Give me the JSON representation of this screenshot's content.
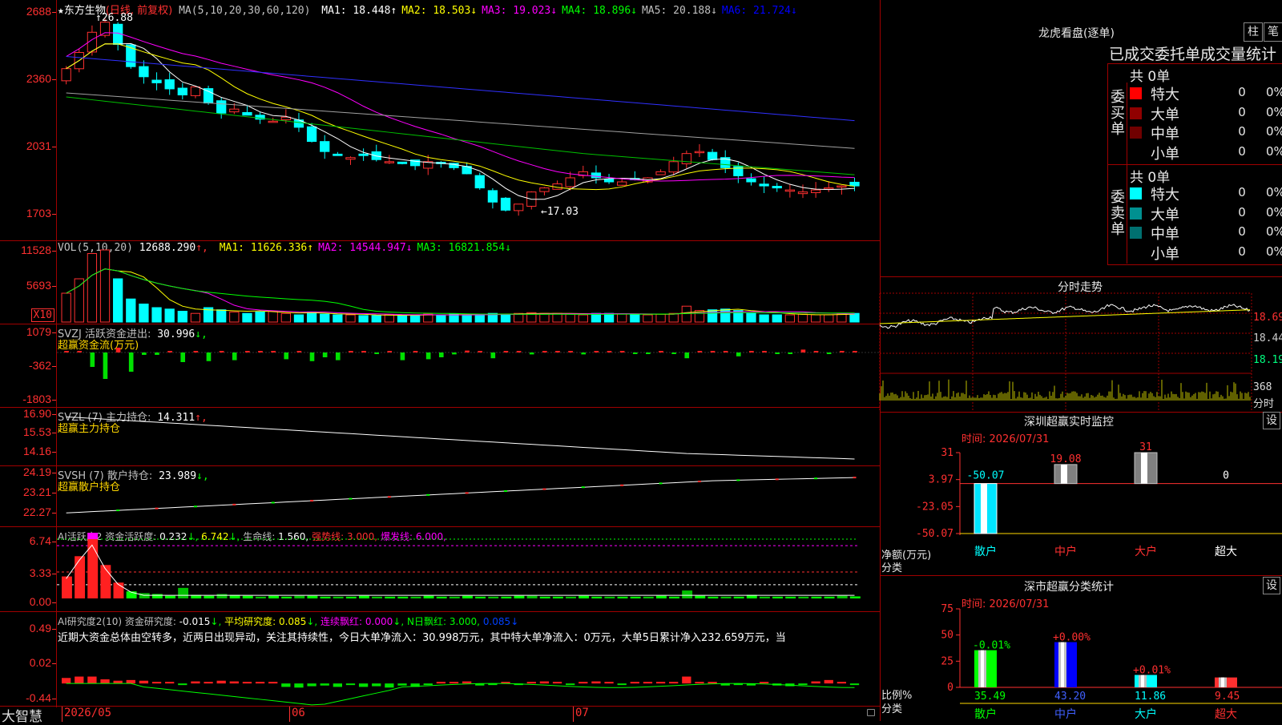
{
  "stock": {
    "name": "东方生物",
    "mode": "(日线, 前复权)",
    "star": "★",
    "ma_header": "MA(5,10,20,30,60,120)",
    "ma": [
      {
        "label": "MA1:",
        "value": "18.448",
        "arrow": "↑",
        "color": "#ffffff"
      },
      {
        "label": "MA2:",
        "value": "18.503",
        "arrow": "↓",
        "color": "#ffff00"
      },
      {
        "label": "MA3:",
        "value": "19.023",
        "arrow": "↓",
        "color": "#ff00ff"
      },
      {
        "label": "MA4:",
        "value": "18.896",
        "arrow": "↓",
        "color": "#00ff00"
      },
      {
        "label": "MA5:",
        "value": "20.188",
        "arrow": "↓",
        "color": "#c0c0c0"
      },
      {
        "label": "MA6:",
        "value": "21.724",
        "arrow": "↓",
        "color": "#0000ff"
      }
    ],
    "high_note": "26.88",
    "low_note": "17.03",
    "y_ticks": [
      "2688",
      "2360",
      "2031",
      "1703"
    ]
  },
  "vol": {
    "title": "VOL(5,10,20)",
    "value": "12688.290",
    "ma": [
      {
        "label": "MA1:",
        "value": "11626.336",
        "arrow": "↑",
        "color": "#ffff00"
      },
      {
        "label": "MA2:",
        "value": "14544.947",
        "arrow": "↓",
        "color": "#ff00ff"
      },
      {
        "label": "MA3:",
        "value": "16821.854",
        "arrow": "↓",
        "color": "#00ff00"
      }
    ],
    "y_ticks": [
      "11528",
      "5693"
    ],
    "unit": "X10"
  },
  "svzj": {
    "title": "SVZJ  活跃资金进出:",
    "value": "30.996",
    "arrow": "↓,",
    "subtitle": "超赢资金流(万元)",
    "y_ticks": [
      "1079",
      "-362",
      "-1803"
    ]
  },
  "svzl": {
    "title": "SVZL (7) 主力持仓:",
    "value": "14.311",
    "arrow": "↑,",
    "subtitle": "超赢主力持仓",
    "y_ticks": [
      "16.90",
      "15.53",
      "14.16"
    ]
  },
  "svsh": {
    "title": "SVSH (7) 散户持仓:",
    "value": "23.989",
    "arrow": "↓,",
    "subtitle": "超赢散户持仓",
    "y_ticks": [
      "24.19",
      "23.21",
      "22.27"
    ]
  },
  "ai1": {
    "title": "AI活跃度2 资金活跃度:",
    "value": "0.232",
    "arrow": "↓,",
    "v2": "6.742",
    "life": "生命线:",
    "life_val": "1.560,",
    "strong": "强势线:",
    "strong_val": "3.000,",
    "burst": "爆发线:",
    "burst_val": "6.000,",
    "y_ticks": [
      "6.74",
      "3.33",
      "0.00"
    ]
  },
  "ai2": {
    "title": "AI研究度2(10) 资金研究度:",
    "value": "-0.015",
    "arrow": "↓,",
    "avg": "平均研究度:",
    "avg_val": "0.085",
    "cont": "连续飘红:",
    "cont_val": "0.000",
    "nday": "N日飘红:",
    "nday_val": "3.000,",
    "extra": "0.085",
    "comment": "近期大资金总体由空转多，近两日出现异动，关注其持续性，今日大单净流入：30.998万元，其中特大单净流入：0万元，大单5日累计净入232.659万元，当",
    "y_ticks": [
      "0.49",
      "0.02",
      "-0.44"
    ]
  },
  "bottom": {
    "brand": "大智慧",
    "dates": [
      "2026/05",
      "06",
      "07"
    ]
  },
  "lhb": {
    "title": "龙虎看盘(逐单)",
    "btn1": "柱",
    "btn2": "笔",
    "header": "已成交委托单成交量统计",
    "buy_label": "委买单",
    "sell_label": "委卖单",
    "buy_total": "共 0单",
    "sell_total": "共 0单",
    "buy_rows": [
      {
        "label": "特大",
        "count": "0",
        "pct": "0%",
        "color": "#ff0000"
      },
      {
        "label": "大单",
        "count": "0",
        "pct": "0%",
        "color": "#900000"
      },
      {
        "label": "中单",
        "count": "0",
        "pct": "0%",
        "color": "#700000"
      },
      {
        "label": "小单",
        "count": "0",
        "pct": "0%",
        "color": "#000000"
      }
    ],
    "sell_rows": [
      {
        "label": "特大",
        "count": "0",
        "pct": "0%",
        "color": "#00ffff"
      },
      {
        "label": "大单",
        "count": "0",
        "pct": "0%",
        "color": "#009090"
      },
      {
        "label": "中单",
        "count": "0",
        "pct": "0%",
        "color": "#007070"
      },
      {
        "label": "小单",
        "count": "0",
        "pct": "0%",
        "color": "#000000"
      }
    ]
  },
  "fenshi": {
    "title": "分时走势",
    "y_ticks": [
      "18.69",
      "18.44",
      "18.19"
    ],
    "vol_label": "368",
    "vol_unit": "分时"
  },
  "sz_monitor": {
    "title": "深圳超赢实时监控",
    "btn": "设",
    "time": "时间: 2026/07/31",
    "y_ticks": [
      "31",
      "3.97",
      "-23.05",
      "-50.07"
    ],
    "ylabel": "净额(万元)",
    "xlabel": "分类",
    "categories": [
      "散户",
      "中户",
      "大户",
      "超大"
    ],
    "values": [
      -50.07,
      19.08,
      31,
      0
    ],
    "value_labels": [
      "-50.07",
      "19.08",
      "31",
      "0"
    ]
  },
  "sz_class": {
    "title": "深市超赢分类统计",
    "btn": "设",
    "time": "时间: 2026/07/31",
    "y_ticks": [
      "75",
      "50",
      "25",
      "0"
    ],
    "ylabel": "比例%",
    "xlabel": "分类",
    "categories": [
      "散户",
      "中户",
      "大户",
      "超大"
    ],
    "values": [
      35.49,
      43.2,
      11.86,
      9.45
    ],
    "changes": [
      "-0.01%",
      "+0.00%",
      "+0.01%",
      ""
    ],
    "value_labels": [
      "35.49",
      "43.20",
      "11.86",
      "9.45"
    ]
  }
}
